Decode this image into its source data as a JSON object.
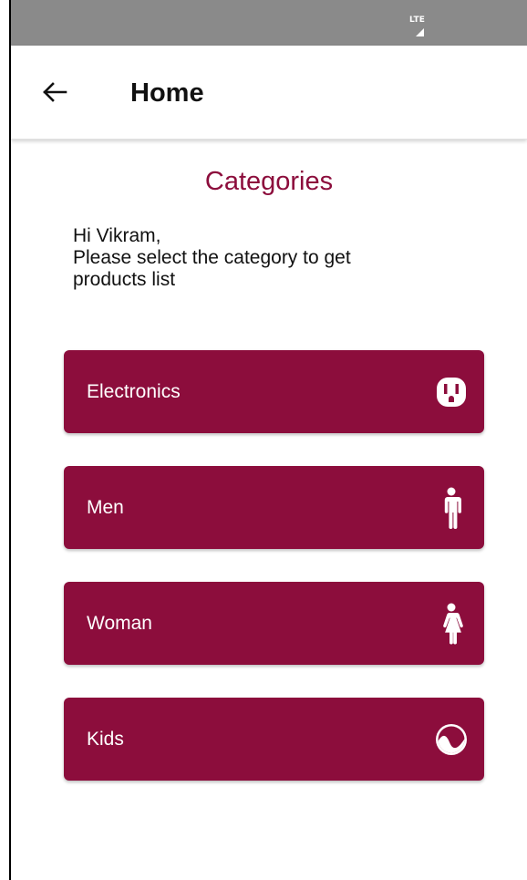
{
  "status_bar": {
    "network": "LTE"
  },
  "app_bar": {
    "back_icon": "arrow-left-icon",
    "title": "Home"
  },
  "main": {
    "title": "Categories",
    "greeting_line1": "Hi Vikram,",
    "greeting_line2": "Please select the category to get",
    "greeting_line3": "products list",
    "categories": [
      {
        "label": "Electronics",
        "icon": "power-outlet-icon"
      },
      {
        "label": "Men",
        "icon": "male-icon"
      },
      {
        "label": "Woman",
        "icon": "female-icon"
      },
      {
        "label": "Kids",
        "icon": "circle-wave-icon"
      }
    ]
  },
  "colors": {
    "accent": "#8c0d3c",
    "status_bar": "#8a8a8a",
    "app_bar": "#ffffff",
    "text_dark": "#111111",
    "button_text": "#ffffff"
  }
}
